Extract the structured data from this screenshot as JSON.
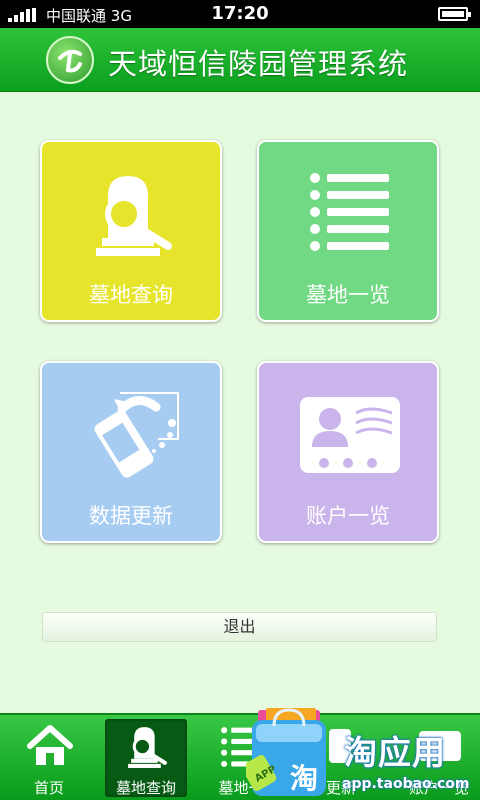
{
  "status_bar": {
    "carrier": "中国联通",
    "network": "3G",
    "time": "17:20"
  },
  "header": {
    "title": "天域恒信陵园管理系统"
  },
  "tiles": [
    {
      "label": "墓地查询",
      "color": "#e7e42c",
      "icon": "tombstone-search-icon"
    },
    {
      "label": "墓地一览",
      "color": "#71d883",
      "icon": "list-icon"
    },
    {
      "label": "数据更新",
      "color": "#a6cdf1",
      "icon": "phone-sync-icon"
    },
    {
      "label": "账户一览",
      "color": "#c9b4ec",
      "icon": "id-card-icon"
    }
  ],
  "logout_label": "退出",
  "tab_bar": {
    "active_index": 1,
    "items": [
      {
        "label": "首页",
        "icon": "home-icon"
      },
      {
        "label": "墓地查询",
        "icon": "tombstone-search-icon"
      },
      {
        "label": "墓地一",
        "icon": "list-icon"
      },
      {
        "label": "更新",
        "icon": "sync-icon"
      },
      {
        "label": "账户一览",
        "icon": "account-icon"
      }
    ]
  },
  "ad_overlay": {
    "brand": "淘应用",
    "url": "app.taobao.com",
    "bag_badge": "APP",
    "bag_char": "淘"
  },
  "colors": {
    "primary_green": "#0a9f1d",
    "background": "#e6fae0"
  }
}
